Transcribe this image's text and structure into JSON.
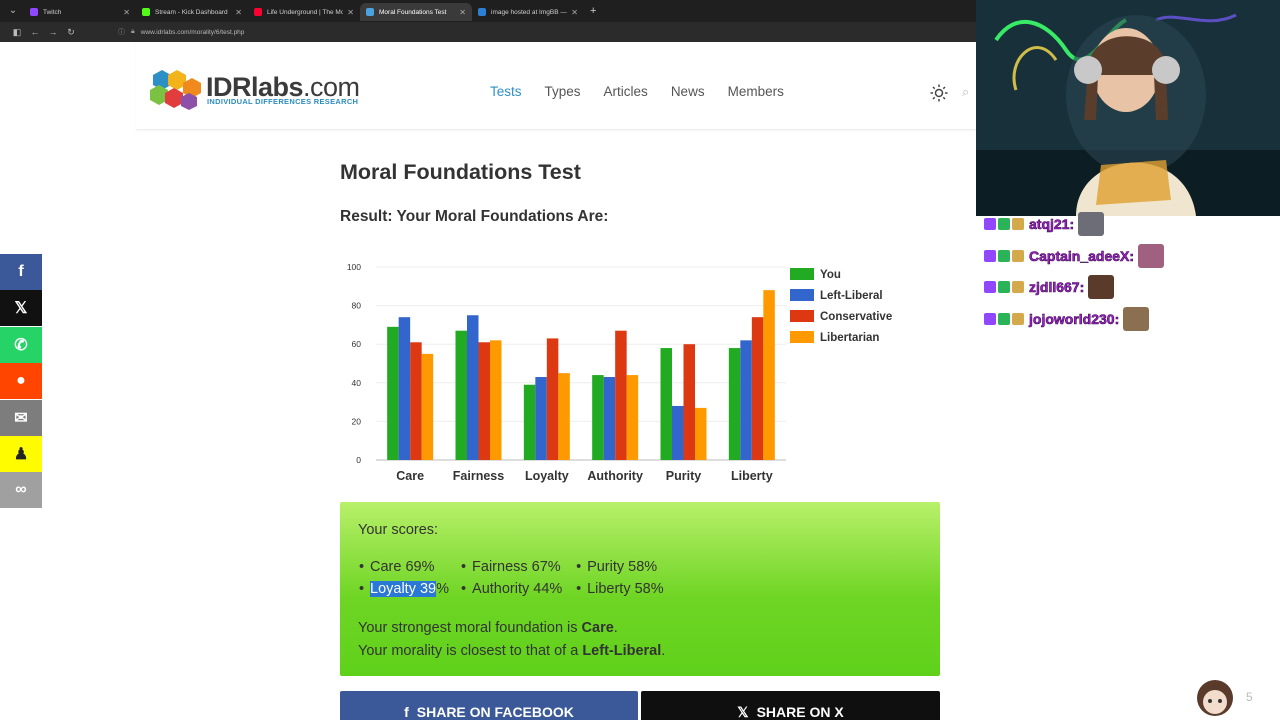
{
  "browser": {
    "tabs": [
      {
        "title": "Twitch",
        "color": "#9146ff",
        "active": false
      },
      {
        "title": "Stream - Kick Dashboard",
        "color": "#53fc18",
        "active": false
      },
      {
        "title": "Life Underground | The Mole F",
        "color": "#ff0033",
        "active": false
      },
      {
        "title": "Moral Foundations Test",
        "color": "#4aa3df",
        "active": true
      },
      {
        "title": "image hosted at ImgBB — Imgb",
        "color": "#2d7fd3",
        "active": false
      }
    ],
    "url": "www.idrlabs.com/morality/6/test.php"
  },
  "site": {
    "logo_main": "IDRlabs",
    "logo_suffix": ".com",
    "logo_sub": "INDIVIDUAL DIFFERENCES RESEARCH",
    "nav": [
      "Tests",
      "Types",
      "Articles",
      "News",
      "Members"
    ],
    "active_nav": "Tests"
  },
  "share_sidebar": [
    {
      "icon": "facebook-icon",
      "glyph": "f",
      "color": "#3b5998"
    },
    {
      "icon": "x-icon",
      "glyph": "𝕏",
      "color": "#111111"
    },
    {
      "icon": "whatsapp-icon",
      "glyph": "✆",
      "color": "#25d366"
    },
    {
      "icon": "reddit-icon",
      "glyph": "●",
      "color": "#ff4500"
    },
    {
      "icon": "email-icon",
      "glyph": "✉",
      "color": "#7d7d7d"
    },
    {
      "icon": "snapchat-icon",
      "glyph": "♟",
      "color": "#fffc00"
    },
    {
      "icon": "link-icon",
      "glyph": "∞",
      "color": "#a0a0a0"
    }
  ],
  "content": {
    "title": "Moral Foundations Test",
    "result_title": "Result: Your Moral Foundations Are:",
    "scores_header": "Your scores:",
    "scores_row1": [
      "Care 69%",
      "Fairness 67%",
      "Purity 58%"
    ],
    "scores_row2_selected": "Loyalty 39",
    "scores_row2_first_rest": "%",
    "scores_row2": [
      "Authority 44%",
      "Liberty 58%"
    ],
    "strongest_prefix": "Your strongest moral foundation is ",
    "strongest_value": "Care",
    "strongest_suffix": ".",
    "closest_prefix": "Your morality is closest to that of a ",
    "closest_value": "Left-Liberal",
    "closest_suffix": ".",
    "share_facebook": "SHARE ON FACEBOOK",
    "share_x": "SHARE ON X"
  },
  "chart_data": {
    "type": "bar",
    "categories": [
      "Care",
      "Fairness",
      "Loyalty",
      "Authority",
      "Purity",
      "Liberty"
    ],
    "series": [
      {
        "name": "You",
        "color": "#22aa22",
        "values": [
          69,
          67,
          39,
          44,
          58,
          58
        ]
      },
      {
        "name": "Left-Liberal",
        "color": "#3366cc",
        "values": [
          74,
          75,
          43,
          43,
          28,
          62
        ]
      },
      {
        "name": "Conservative",
        "color": "#dc3912",
        "values": [
          61,
          61,
          63,
          67,
          60,
          74
        ]
      },
      {
        "name": "Libertarian",
        "color": "#ff9900",
        "values": [
          55,
          62,
          45,
          44,
          27,
          88
        ]
      }
    ],
    "ylim": [
      0,
      100
    ],
    "yticks": [
      0,
      20,
      40,
      60,
      80,
      100
    ],
    "legend_position": "right",
    "grid": true
  },
  "chat": [
    {
      "user": "atqj21:",
      "color": "#b57cff"
    },
    {
      "user": "Captain_adeeX:",
      "color": "#b57cff"
    },
    {
      "user": "zjdll667:",
      "color": "#b57cff"
    },
    {
      "user": "jojoworld230:",
      "color": "#b57cff"
    }
  ],
  "overlay": {
    "corner_number": "5"
  }
}
